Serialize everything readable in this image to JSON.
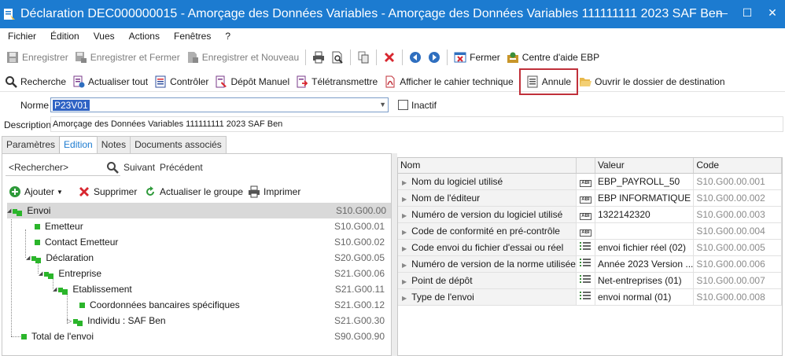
{
  "window": {
    "title": "Déclaration DEC000000015  - Amorçage des Données Variables - Amorçage des Données Variables 111111111 2023 SAF Ben",
    "minimize": "—",
    "maximize": "☐",
    "close": "✕"
  },
  "menu": [
    "Fichier",
    "Édition",
    "Vues",
    "Actions",
    "Fenêtres",
    "?"
  ],
  "toolbar1": {
    "save": "Enregistrer",
    "save_close": "Enregistrer et Fermer",
    "save_new": "Enregistrer et Nouveau",
    "close": "Fermer",
    "help": "Centre d'aide EBP"
  },
  "toolbar2": {
    "search": "Recherche",
    "refresh_all": "Actualiser tout",
    "check": "Contrôler",
    "manual_deposit": "Dépôt Manuel",
    "teletransmit": "Télétransmettre",
    "spec": "Afficher le cahier technique",
    "cancel": "Annule",
    "open_folder": "Ouvrir le dossier de destination"
  },
  "form": {
    "name_label": "Norme",
    "name_value": "P23V01",
    "inactive_label": "Inactif",
    "description_label": "Description",
    "description_value": "Amorçage des Données Variables 111111111 2023 SAF Ben"
  },
  "tabs": [
    "Paramètres",
    "Edition",
    "Notes",
    "Documents associés"
  ],
  "left": {
    "search_placeholder": "<Rechercher>",
    "next": "Suivant",
    "previous": "Précédent",
    "add": "Ajouter",
    "delete": "Supprimer",
    "refresh_group": "Actualiser le groupe",
    "print": "Imprimer",
    "tree": [
      {
        "label": "Envoi",
        "code": "S10.G00.00"
      },
      {
        "label": "Emetteur",
        "code": "S10.G00.01"
      },
      {
        "label": "Contact Emetteur",
        "code": "S10.G00.02"
      },
      {
        "label": "Déclaration",
        "code": "S20.G00.05"
      },
      {
        "label": "Entreprise",
        "code": "S21.G00.06"
      },
      {
        "label": "Etablissement",
        "code": "S21.G00.11"
      },
      {
        "label": "Coordonnées bancaires spécifiques",
        "code": "S21.G00.12"
      },
      {
        "label": "Individu : SAF Ben",
        "code": "S21.G00.30"
      },
      {
        "label": "Total de l'envoi",
        "code": "S90.G00.90"
      }
    ]
  },
  "grid": {
    "headers": [
      "Nom",
      "Valeur",
      "Code"
    ],
    "rows": [
      {
        "name": "Nom du logiciel utilisé",
        "value": "EBP_PAYROLL_50",
        "code": "S10.G00.00.001",
        "icon": "abc-icon"
      },
      {
        "name": "Nom de l'éditeur",
        "value": "EBP INFORMATIQUE",
        "code": "S10.G00.00.002",
        "icon": "abc-icon"
      },
      {
        "name": "Numéro de version du logiciel utilisé",
        "value": "1322142320",
        "code": "S10.G00.00.003",
        "icon": "abc-icon"
      },
      {
        "name": "Code de conformité en pré-contrôle",
        "value": "",
        "code": "S10.G00.00.004",
        "icon": "abc-icon"
      },
      {
        "name": "Code envoi du fichier d'essai ou réel",
        "value": "envoi fichier réel (02)",
        "code": "S10.G00.00.005",
        "icon": "list-icon"
      },
      {
        "name": "Numéro de version de la norme utilisée",
        "value": "Année 2023 Version ...",
        "code": "S10.G00.00.006",
        "icon": "list-icon"
      },
      {
        "name": "Point de dépôt",
        "value": "Net-entreprises (01)",
        "code": "S10.G00.00.007",
        "icon": "list-icon"
      },
      {
        "name": "Type de l'envoi",
        "value": "envoi normal (01)",
        "code": "S10.G00.00.008",
        "icon": "list-icon"
      }
    ]
  },
  "colors": {
    "titlebar": "#1c7bd0",
    "highlight": "#c0303a",
    "tree_node": "#2bb52b"
  }
}
